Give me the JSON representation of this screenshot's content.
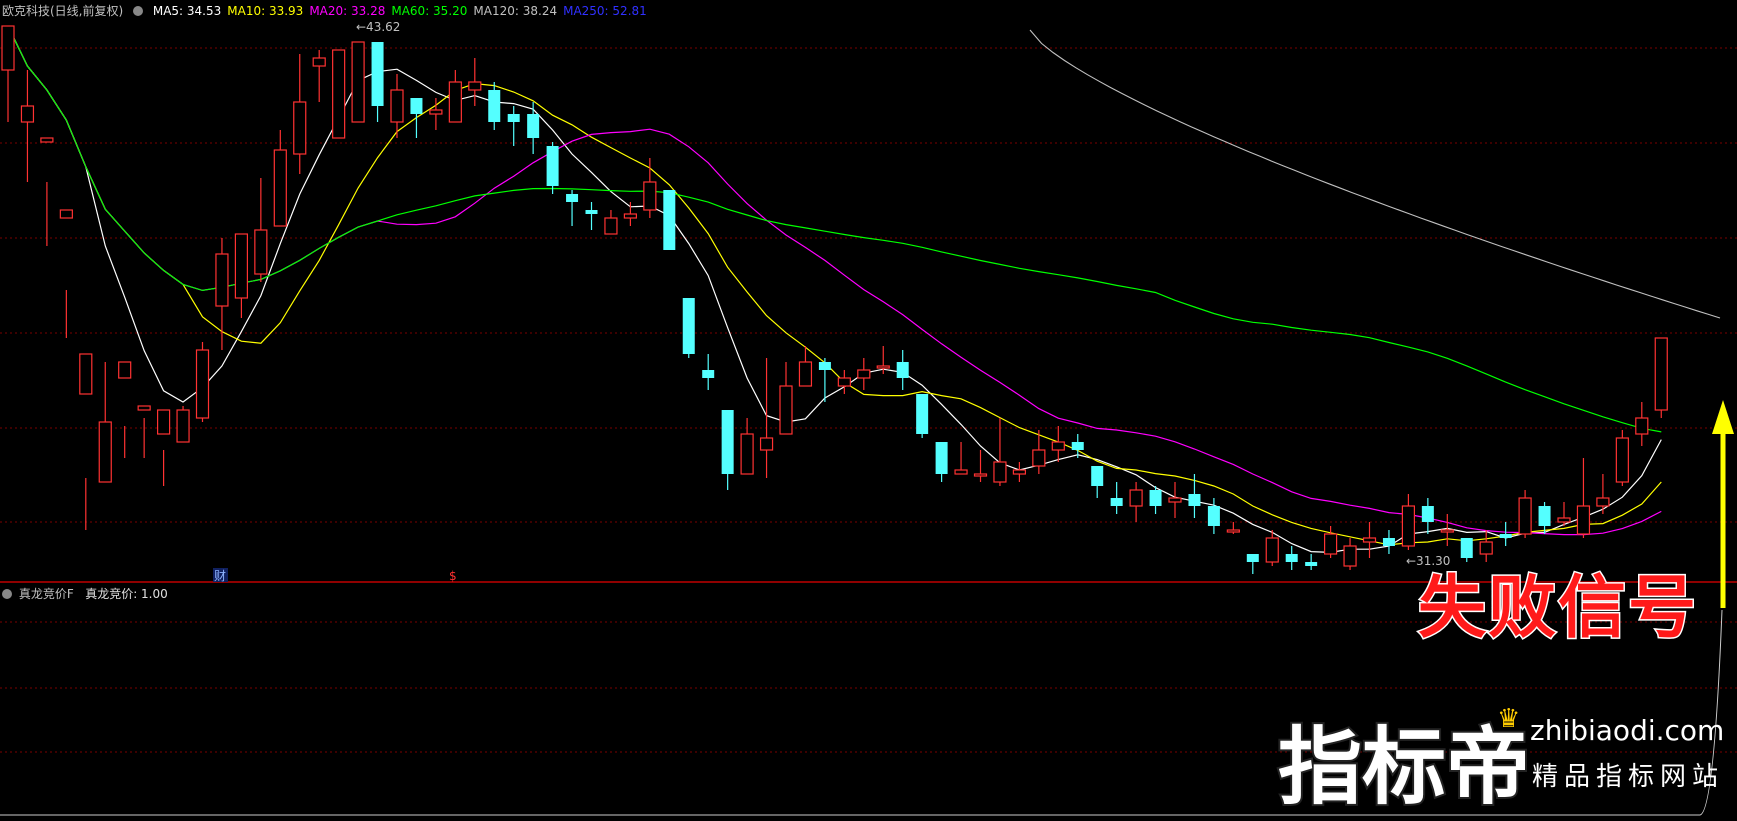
{
  "header": {
    "stock_title": "欧克科技(日线,前复权)",
    "legend": [
      {
        "label": "MA5: 34.53",
        "color": "#ffffff"
      },
      {
        "label": "MA10: 33.93",
        "color": "#ffff00"
      },
      {
        "label": "MA20: 33.28",
        "color": "#ff00ff"
      },
      {
        "label": "MA60: 35.20",
        "color": "#00ff00"
      },
      {
        "label": "MA120: 38.24",
        "color": "#c0c0c0"
      },
      {
        "label": "MA250: 52.81",
        "color": "#3030ff"
      }
    ]
  },
  "annotations": {
    "high_label": "←43.62",
    "low_label": "←31.30",
    "marker_cai": "财",
    "marker_s": "$",
    "signal_text": "失败信号"
  },
  "subpanel": {
    "indicator_name": "真龙竞价F",
    "value_label": "真龙竞价: 1.00"
  },
  "watermark": {
    "brand": "指标帝",
    "url": "zhibiaodi.com",
    "tagline": "精品指标网站"
  },
  "colors": {
    "up": "#ff3232",
    "down": "#54ffff",
    "grid": "#7a0000",
    "ma5": "#ffffff",
    "ma10": "#ffff00",
    "ma20": "#ff00ff",
    "ma60": "#00ff00",
    "ma120": "#c0c0c0",
    "arrow": "#ffff00"
  },
  "chart_data": {
    "type": "candlestick",
    "ylim": [
      30.4,
      44.4
    ],
    "candles": [
      [
        42.9,
        44.0,
        43.3,
        41.6
      ],
      [
        41.6,
        42.0,
        42.9,
        40.1
      ],
      [
        41.1,
        41.2,
        40.1,
        38.5
      ],
      [
        39.2,
        39.4,
        37.4,
        36.2
      ],
      [
        34.8,
        35.8,
        32.7,
        31.4
      ],
      [
        32.6,
        34.1,
        35.6,
        32.6
      ],
      [
        35.2,
        35.6,
        34.0,
        33.2
      ],
      [
        34.4,
        34.5,
        34.2,
        33.2
      ],
      [
        33.8,
        34.4,
        33.4,
        32.5
      ],
      [
        33.6,
        34.4,
        34.5,
        33.6
      ],
      [
        34.2,
        35.9,
        36.1,
        34.1
      ],
      [
        37.0,
        38.3,
        38.7,
        35.9
      ],
      [
        37.2,
        38.8,
        37.5,
        36.7
      ],
      [
        37.8,
        38.9,
        40.2,
        37.6
      ],
      [
        39.0,
        40.9,
        41.4,
        39.0
      ],
      [
        40.8,
        42.1,
        43.3,
        40.3
      ],
      [
        43.0,
        43.2,
        43.4,
        42.1
      ],
      [
        41.2,
        43.4,
        43.4,
        41.2
      ],
      [
        41.6,
        43.6,
        43.6,
        41.6
      ],
      [
        43.6,
        42.0,
        43.6,
        41.6
      ],
      [
        41.6,
        42.4,
        42.8,
        41.2
      ],
      [
        42.2,
        41.8,
        42.2,
        41.2
      ],
      [
        41.8,
        41.9,
        42.2,
        41.4
      ],
      [
        41.6,
        42.6,
        42.9,
        41.6
      ],
      [
        42.4,
        42.6,
        43.2,
        42.0
      ],
      [
        42.4,
        41.6,
        42.6,
        41.4
      ],
      [
        41.8,
        41.6,
        42.0,
        41.0
      ],
      [
        41.8,
        41.2,
        42.1,
        40.8
      ],
      [
        41.0,
        40.0,
        41.1,
        39.8
      ],
      [
        39.8,
        39.6,
        39.9,
        39.0
      ],
      [
        39.4,
        39.3,
        39.6,
        38.9
      ],
      [
        38.8,
        39.2,
        39.4,
        38.8
      ],
      [
        39.2,
        39.3,
        39.6,
        39.0
      ],
      [
        39.4,
        40.1,
        40.7,
        39.2
      ],
      [
        39.9,
        38.4,
        39.9,
        38.4
      ],
      [
        37.2,
        35.8,
        37.2,
        35.7
      ],
      [
        35.4,
        35.2,
        35.8,
        34.9
      ],
      [
        34.4,
        32.8,
        34.4,
        32.4
      ],
      [
        32.8,
        33.8,
        34.2,
        32.8
      ],
      [
        33.4,
        33.7,
        35.7,
        32.7
      ],
      [
        33.8,
        35.0,
        35.6,
        33.8
      ],
      [
        35.0,
        35.6,
        36.0,
        35.0
      ],
      [
        35.6,
        35.4,
        35.7,
        34.6
      ],
      [
        35.0,
        35.2,
        35.4,
        34.8
      ],
      [
        35.2,
        35.4,
        35.7,
        34.9
      ],
      [
        35.5,
        35.5,
        36.0,
        35.3
      ],
      [
        35.6,
        35.2,
        35.9,
        34.9
      ],
      [
        34.8,
        33.8,
        34.8,
        33.7
      ],
      [
        33.6,
        32.8,
        33.6,
        32.6
      ],
      [
        32.8,
        32.9,
        33.6,
        32.8
      ],
      [
        32.8,
        32.8,
        33.4,
        32.6
      ],
      [
        32.6,
        33.1,
        34.2,
        32.5
      ],
      [
        32.8,
        32.9,
        33.1,
        32.6
      ],
      [
        33.0,
        33.4,
        33.9,
        32.8
      ],
      [
        33.4,
        33.6,
        34.0,
        33.1
      ],
      [
        33.6,
        33.4,
        33.8,
        33.2
      ],
      [
        33.0,
        32.5,
        33.0,
        32.2
      ],
      [
        32.2,
        32.0,
        32.6,
        31.8
      ],
      [
        32.0,
        32.4,
        32.6,
        31.6
      ],
      [
        32.4,
        32.0,
        32.5,
        31.8
      ],
      [
        32.1,
        32.2,
        32.6,
        31.7
      ],
      [
        32.3,
        32.0,
        32.8,
        31.7
      ],
      [
        32.0,
        31.5,
        32.2,
        31.3
      ],
      [
        31.4,
        31.4,
        31.6,
        31.3
      ],
      [
        30.8,
        30.6,
        30.8,
        30.3
      ],
      [
        30.6,
        31.2,
        31.4,
        30.5
      ],
      [
        30.8,
        30.6,
        31.0,
        30.4
      ],
      [
        30.6,
        30.5,
        30.8,
        30.4
      ],
      [
        30.8,
        31.3,
        31.5,
        30.7
      ],
      [
        30.5,
        31.0,
        31.2,
        30.4
      ],
      [
        31.1,
        31.2,
        31.6,
        30.7
      ],
      [
        31.2,
        31.0,
        31.4,
        30.8
      ],
      [
        31.0,
        32.0,
        32.3,
        30.9
      ],
      [
        32.0,
        31.6,
        32.2,
        31.3
      ],
      [
        31.4,
        31.4,
        31.8,
        31.0
      ],
      [
        31.2,
        30.7,
        31.2,
        30.6
      ],
      [
        30.8,
        31.1,
        31.4,
        30.6
      ],
      [
        31.3,
        31.2,
        31.6,
        31.0
      ],
      [
        31.3,
        32.2,
        32.4,
        31.2
      ],
      [
        32.0,
        31.5,
        32.1,
        31.3
      ],
      [
        31.6,
        31.7,
        32.1,
        31.5
      ],
      [
        31.3,
        32.0,
        33.2,
        31.2
      ],
      [
        32.0,
        32.2,
        32.8,
        31.8
      ],
      [
        32.6,
        33.7,
        33.9,
        32.5
      ],
      [
        33.8,
        34.2,
        34.6,
        33.5
      ],
      [
        34.4,
        36.2,
        36.2,
        34.2
      ]
    ],
    "ma_legend": [
      "MA5",
      "MA10",
      "MA20",
      "MA60",
      "MA120",
      "MA250"
    ]
  }
}
